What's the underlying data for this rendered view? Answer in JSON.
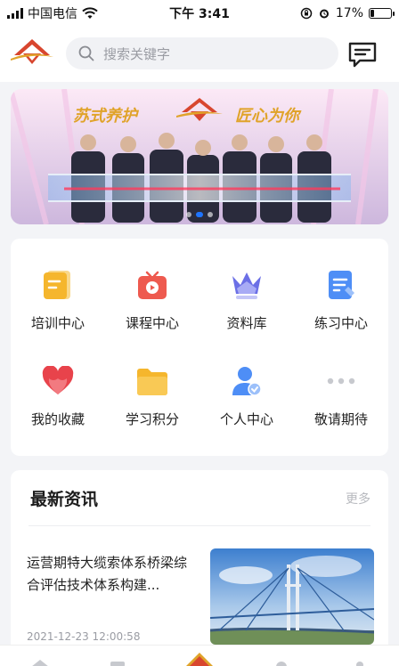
{
  "status_bar": {
    "carrier": "中国电信",
    "time": "下午 3:41",
    "battery_percent": "17%",
    "battery_level": 0.17
  },
  "header": {
    "search_placeholder": "搜索关键字",
    "icons": {
      "logo": "app-logo-icon",
      "search": "search-icon",
      "message": "message-icon"
    }
  },
  "banner": {
    "slogan_left": "苏式养护",
    "slogan_right": "匠心为你"
  },
  "menu": [
    {
      "label": "培训中心",
      "icon": "training-center-icon",
      "color": "#f5b62d"
    },
    {
      "label": "课程中心",
      "icon": "course-center-icon",
      "color": "#ee5a4f"
    },
    {
      "label": "资料库",
      "icon": "library-icon",
      "color": "#6b6fe6"
    },
    {
      "label": "练习中心",
      "icon": "practice-center-icon",
      "color": "#4e8ef6"
    },
    {
      "label": "我的收藏",
      "icon": "favorites-icon",
      "color": "#e8434b"
    },
    {
      "label": "学习积分",
      "icon": "points-icon",
      "color": "#f5b62d"
    },
    {
      "label": "个人中心",
      "icon": "profile-icon",
      "color": "#4e8ef6"
    },
    {
      "label": "敬请期待",
      "icon": "more-icon",
      "color": "#c7c9ce"
    }
  ],
  "news": {
    "section_title": "最新资讯",
    "more_label": "更多",
    "items": [
      {
        "headline": "运营期特大缆索体系桥梁综合评估技术体系构建...",
        "date": "2021-12-23 12:00:58"
      }
    ]
  },
  "colors": {
    "accent": "#1e74ff",
    "brand_red": "#d8462f",
    "brand_gold": "#e0a32a"
  }
}
